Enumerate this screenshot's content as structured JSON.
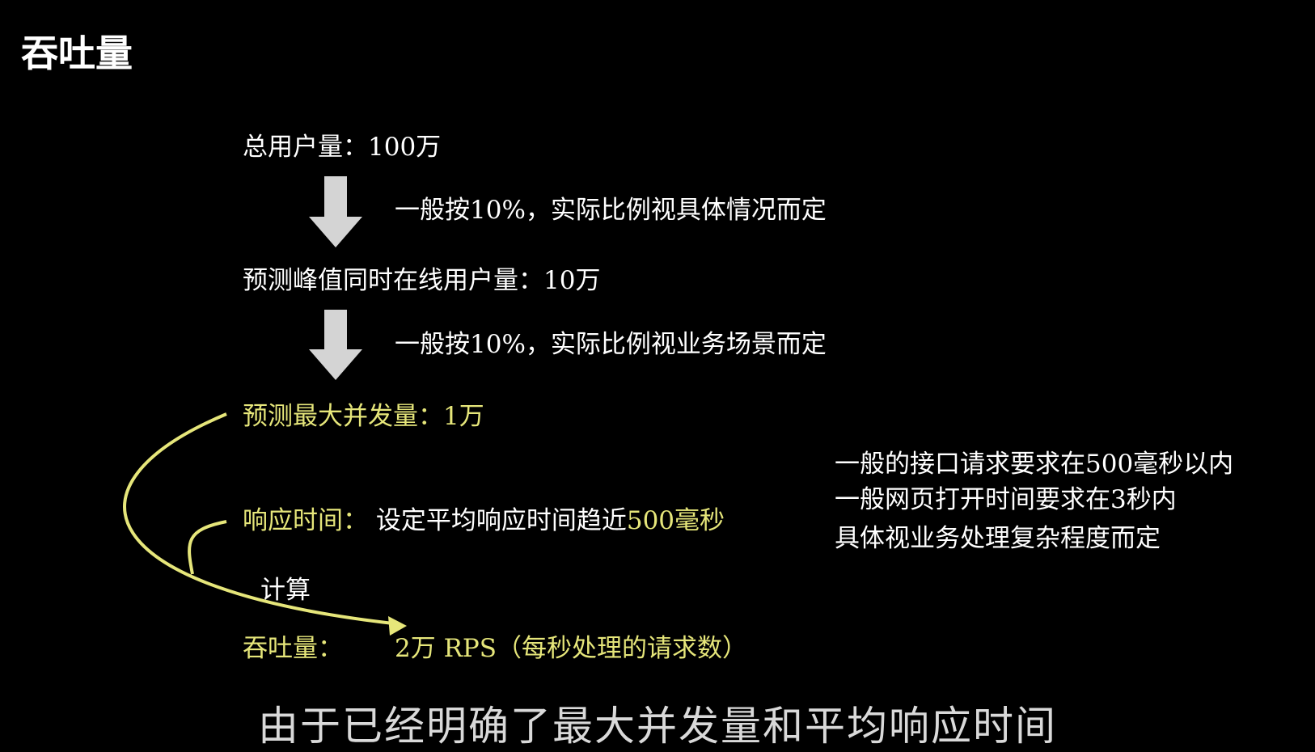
{
  "title": "吞吐量",
  "steps": {
    "total_users": "总用户量：100万",
    "arrow1_note": "一般按10%，实际比例视具体情况而定",
    "peak_online": "预测峰值同时在线用户量：10万",
    "arrow2_note": "一般按10%，实际比例视业务场景而定",
    "max_concurrency": "预测最大并发量：1万",
    "response_label": "响应时间：",
    "response_text": "设定平均响应时间趋近",
    "response_value": "500毫秒",
    "calc_label": "计算",
    "throughput_label": "吞吐量：",
    "throughput_value": "2万 RPS（每秒处理的请求数）"
  },
  "side_notes": [
    "一般的接口请求要求在500毫秒以内",
    "一般网页打开时间要求在3秒内",
    "具体视业务处理复杂程度而定"
  ],
  "subtitle": "由于已经明确了最大并发量和平均响应时间",
  "colors": {
    "background": "#000000",
    "text": "#ffffff",
    "highlight": "#e6e67a",
    "arrow": "#d4d4d4"
  }
}
